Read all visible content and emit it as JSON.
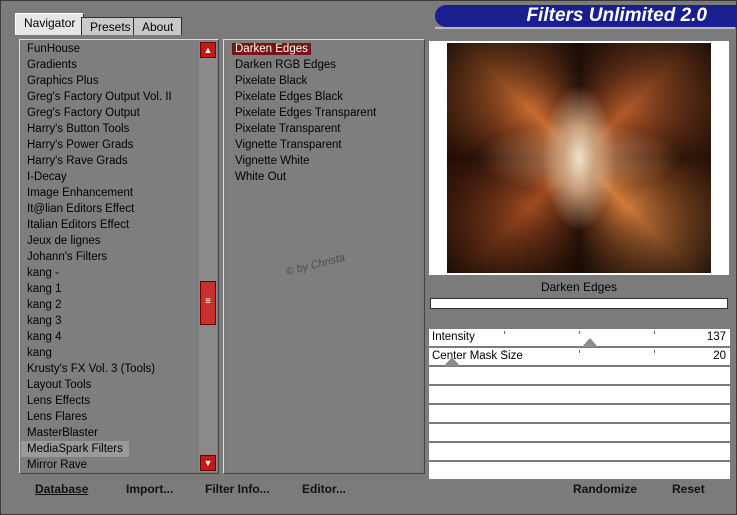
{
  "app": {
    "brand": "Filters Unlimited 2.0"
  },
  "tabs": [
    {
      "label": "Navigator",
      "active": true
    },
    {
      "label": "Presets",
      "active": false
    },
    {
      "label": "About",
      "active": false
    }
  ],
  "categories": [
    "FunHouse",
    "Gradients",
    "Graphics Plus",
    "Greg's Factory Output Vol. II",
    "Greg's Factory Output",
    "Harry's Button Tools",
    "Harry's Power Grads",
    "Harry's Rave Grads",
    "I-Decay",
    "Image Enhancement",
    "It@lian Editors Effect",
    "Italian Editors Effect",
    "Jeux de lignes",
    "Johann's Filters",
    "kang -",
    "kang 1",
    "kang 2",
    "kang 3",
    "kang 4",
    "kang",
    "Krusty's FX Vol. 3 (Tools)",
    "Layout Tools",
    "Lens Effects",
    "Lens Flares",
    "MasterBlaster",
    "MediaSpark Filters",
    "Mirror Rave"
  ],
  "selected_category": "MediaSpark Filters",
  "filters": [
    "Darken Edges",
    "Darken RGB Edges",
    "Pixelate Black",
    "Pixelate Edges Black",
    "Pixelate Edges Transparent",
    "Pixelate Transparent",
    "Vignette Transparent",
    "Vignette White",
    "White Out"
  ],
  "selected_filter": "Darken Edges",
  "watermark": "© by Christa",
  "preview": {
    "filter_name": "Darken Edges"
  },
  "sliders": [
    {
      "label": "Intensity",
      "value": "137",
      "fraction": 0.537
    },
    {
      "label": "Center Mask Size",
      "value": "20",
      "fraction": 0.078
    }
  ],
  "buttons": {
    "database": "Database",
    "import": "Import...",
    "filter_info": "Filter Info...",
    "editor": "Editor...",
    "randomize": "Randomize",
    "reset": "Reset"
  },
  "colors": {
    "selection": "#7a1414",
    "brand": "#1a1f8f",
    "scroll": "#c01a1a"
  }
}
